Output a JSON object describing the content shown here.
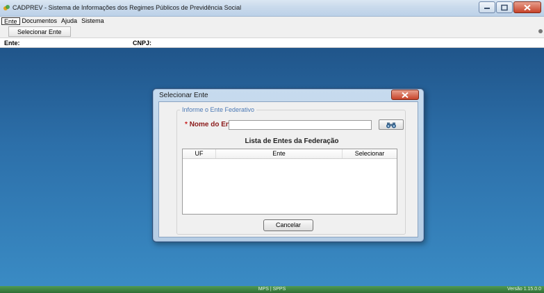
{
  "window": {
    "title": "CADPREV - Sistema de Informações dos Regimes Públicos de Previdência Social"
  },
  "menu": {
    "items": [
      {
        "label": "Ente"
      },
      {
        "label": "Documentos"
      },
      {
        "label": "Ajuda"
      },
      {
        "label": "Sistema"
      }
    ]
  },
  "toolbar": {
    "select_entity_label": "Selecionar Ente"
  },
  "infobar": {
    "ente_label": "Ente:",
    "cnpj_label": "CNPJ:"
  },
  "dialog": {
    "title": "Selecionar Ente",
    "group_legend": "Informe o Ente Federativo",
    "required_mark": "*",
    "name_label": "Nome do Ente:",
    "name_value": "",
    "list_title": "Lista de Entes da Federação",
    "columns": [
      "UF",
      "Ente",
      "Selecionar"
    ],
    "rows": [],
    "cancel_label": "Cancelar"
  },
  "status": {
    "center": "MPS | SPPS",
    "version": "Versão 1.15.0.0"
  },
  "colors": {
    "desktop": "#2c6fa9",
    "required_label": "#8b1a1a",
    "legend": "#4b79b5",
    "statusbar": "#3f8744"
  },
  "icons": {
    "app": "app-logo-icon",
    "search": "binoculars-search-icon",
    "close": "close-icon"
  }
}
